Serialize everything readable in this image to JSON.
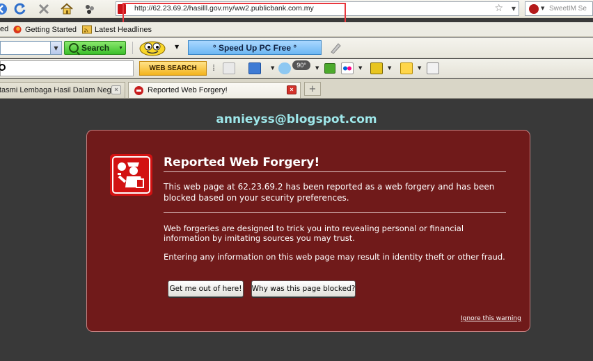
{
  "browser": {
    "url": "http://62.23.69.2/hasilll.gov.my/ww2.publicbank.com.my",
    "search_engine_placeholder": "SweetIM Se"
  },
  "bookmarks": [
    {
      "label": "ed",
      "icon": "red-bookmark-icon"
    },
    {
      "label": "Getting Started",
      "icon": "firefox-icon"
    },
    {
      "label": "Latest Headlines",
      "icon": "rss-feed-icon"
    }
  ],
  "toolbar1": {
    "search_label": "Search",
    "speedup_label": "° Speed Up PC Free °"
  },
  "toolbar2": {
    "web_search_label": "WEB SEARCH",
    "weather_temp": "90°"
  },
  "tabs": [
    {
      "label": "tasmi Lembaga Hasil Dalam Neg...",
      "active": false
    },
    {
      "label": "Reported Web Forgery!",
      "active": true
    }
  ],
  "page": {
    "watermark": "annieyss@blogspot.com",
    "warning": {
      "title": "Reported Web Forgery!",
      "p1": "This web page at 62.23.69.2 has been reported as a web forgery and has been blocked based on your security preferences.",
      "p2": "Web forgeries are designed to trick you into revealing personal or financial information by imitating sources you may trust.",
      "p3": "Entering any information on this web page may result in identity theft or other fraud.",
      "button_get_out": "Get me out of here!",
      "button_why": "Why was this page blocked?",
      "ignore_link": "Ignore this warning"
    }
  },
  "colors": {
    "warning_bg": "#701a1a",
    "page_bg": "#393939",
    "watermark": "#9ee7ea",
    "url_highlight": "#e8383e"
  }
}
